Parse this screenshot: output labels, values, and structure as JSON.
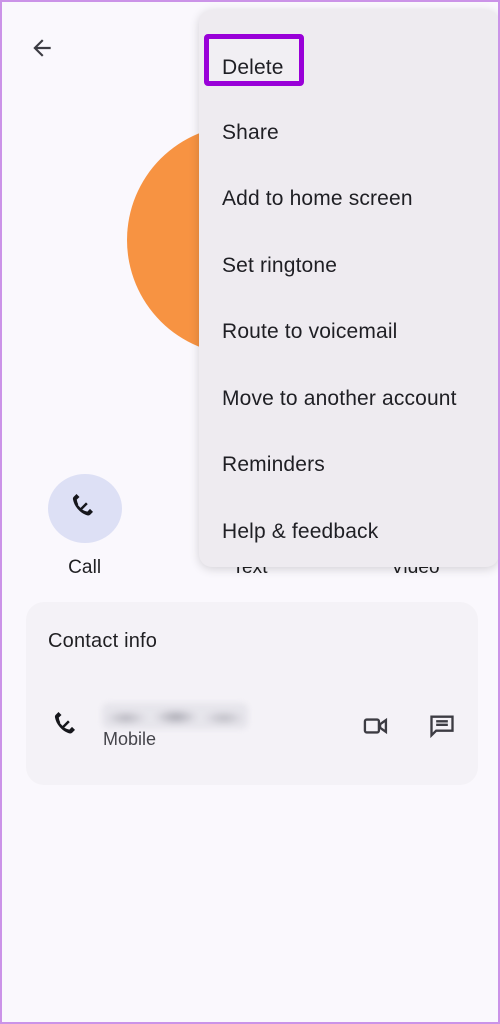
{
  "theme": {
    "page_background": "#faf8fd",
    "frame_border": "#cb93e8",
    "menu_background": "#eeebf0",
    "card_background": "#f4f2f7",
    "avatar_color": "#f79342",
    "highlight_color": "#9900d8",
    "action_circle_color": "#dde0f5",
    "text_primary": "#1f1f22",
    "text_secondary": "#45454b"
  },
  "header": {
    "back_icon": "arrow-left-icon"
  },
  "profile": {
    "avatar_icon": "contact-avatar-circle",
    "avatar_color": "#f79342"
  },
  "quick_actions": [
    {
      "label": "Call",
      "icon": "phone-icon"
    },
    {
      "label": "Text",
      "icon": "message-icon"
    },
    {
      "label": "Video",
      "icon": "video-camera-icon"
    }
  ],
  "contact_card": {
    "title": "Contact info",
    "rows": [
      {
        "icon": "phone-icon",
        "value": "",
        "value_redacted": true,
        "label": "Mobile",
        "actions": [
          {
            "icon": "video-camera-icon",
            "name": "video-call"
          },
          {
            "icon": "message-icon",
            "name": "send-message"
          }
        ]
      }
    ]
  },
  "overflow_menu": {
    "highlighted_index": 0,
    "items": [
      {
        "label": "Delete"
      },
      {
        "label": "Share"
      },
      {
        "label": "Add to home screen"
      },
      {
        "label": "Set ringtone"
      },
      {
        "label": "Route to voicemail"
      },
      {
        "label": "Move to another account"
      },
      {
        "label": "Reminders"
      },
      {
        "label": "Help & feedback"
      }
    ]
  }
}
